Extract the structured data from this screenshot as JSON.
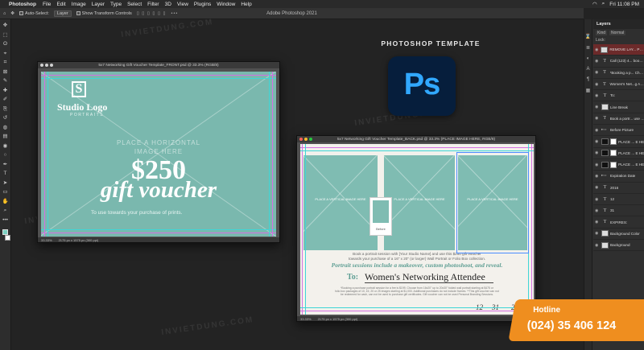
{
  "menubar": {
    "app_name": "Photoshop",
    "items": [
      "File",
      "Edit",
      "Image",
      "Layer",
      "Type",
      "Select",
      "Filter",
      "3D",
      "View",
      "Plugins",
      "Window",
      "Help"
    ],
    "clock": "Fri 11:08 PM",
    "window_title": "Adobe Photoshop 2021"
  },
  "optionsbar": {
    "auto_select_label": "Auto-Select:",
    "auto_select_value": "Layer",
    "show_transform_label": "Show Transform Controls",
    "more": "•••"
  },
  "toolbar": {
    "tools": [
      "move-icon",
      "marquee-icon",
      "lasso-icon",
      "object-select-icon",
      "crop-icon",
      "frame-icon",
      "eyedropper-icon",
      "healing-icon",
      "brush-icon",
      "stamp-icon",
      "history-brush-icon",
      "eraser-icon",
      "gradient-icon",
      "blur-icon",
      "dodge-icon",
      "pen-icon",
      "type-icon",
      "path-select-icon",
      "rectangle-icon",
      "hand-icon",
      "zoom-icon",
      "more-tools-icon"
    ],
    "glyphs": [
      "✥",
      "⬚",
      "ʘ",
      "⌖",
      "⌗",
      "⊠",
      "✎",
      "✚",
      "✐",
      "⎘",
      "↺",
      "◍",
      "▤",
      "◉",
      "○",
      "✒",
      "T",
      "➤",
      "▭",
      "✋",
      "⌕",
      "•••"
    ],
    "fg_color": "#7dd1c2",
    "bg_color": "#ffffff"
  },
  "layers_panel": {
    "tab": "Layers",
    "filter_kind": "Kind",
    "blend_mode": "Normal",
    "lock_label": "Lock:",
    "layers": [
      {
        "name": "REMOVE LAY... PRINTI",
        "type": "image",
        "state": "active-red"
      },
      {
        "name": "Call (123) 4... book yo",
        "type": "text",
        "state": ""
      },
      {
        "name": "*Booking a p... Choose",
        "type": "text",
        "state": ""
      },
      {
        "name": "Women's Net...g Attend",
        "type": "text",
        "state": ""
      },
      {
        "name": "To:",
        "type": "text",
        "state": ""
      },
      {
        "name": "Line Break",
        "type": "image",
        "state": ""
      },
      {
        "name": "Book a portr... use this",
        "type": "text",
        "state": ""
      },
      {
        "name": "Before Picture",
        "type": "folder",
        "state": ""
      },
      {
        "name": "PLACE ... E HE",
        "type": "masked",
        "state": ""
      },
      {
        "name": "PLACE ... E HE",
        "type": "masked",
        "state": ""
      },
      {
        "name": "PLACE ... E HE",
        "type": "masked",
        "state": ""
      },
      {
        "name": "Expiration Date",
        "type": "folder",
        "state": ""
      },
      {
        "name": "2016",
        "type": "text",
        "state": ""
      },
      {
        "name": "12",
        "type": "text",
        "state": ""
      },
      {
        "name": "31",
        "type": "text",
        "state": ""
      },
      {
        "name": "EXPIRES:",
        "type": "text",
        "state": ""
      },
      {
        "name": "Background Color",
        "type": "image",
        "state": ""
      },
      {
        "name": "Background",
        "type": "image",
        "state": ""
      }
    ]
  },
  "front_doc": {
    "title": "5x7 Networking Gift Voucher Template_FRONT.psd @ 33.3% (RGB/8)",
    "zoom": "33.33%",
    "size": "2175 px x 1575 px (300 ppi)",
    "logo_letter": "S",
    "logo_title": "Studio Logo",
    "logo_sub": "PORTRAITS",
    "placeholder": "PLACE A HORIZONTAL",
    "placeholder2": "IMAGE HERE",
    "amount": "$250",
    "gift": "gift voucher",
    "towards": "To use towards your purchase of prints."
  },
  "back_doc": {
    "title": "5x7 Networking Gift Voucher Template_BACK.psd @ 33.3% (PLACE IMAGE HERE, RGB/8)",
    "zoom": "33.33%",
    "size": "2175 px x 1575 px (300 ppi)",
    "photo_label": "PLACE A VERTICAL IMAGE HERE",
    "frame_caption": "Before",
    "body1": "Book a portrait session with [Your Studio Name] and use this $250 gift voucher",
    "body2": "towards your purchase of a 16\" x 20\" (or larger) Wall Portrait or Folio Box collection.",
    "italic": "Portrait sessions include a makeover, custom photoshoot, and reveal.",
    "to_label": "To:",
    "to_name": "Women's Networking Attendee",
    "fine1": "*Booking a purchase portrait session for a fee is $199. Choose from 16x20\" up to 20x30\" folded wall portrait starting at $475 or",
    "fine2": "folio box packages of 10, 15, 20 or 25 images starting at $1,000. Additional purchases do not include frames. **This gift voucher can not",
    "fine3": "be redeemed for cash, can not be used to purchase gift certificates. Gift voucher can not be used Personal Branding Sessions.",
    "date_m": "12",
    "date_d": "31",
    "date_y": "20"
  },
  "branding": {
    "title": "PHOTOSHOP TEMPLATE",
    "logo_text": "Ps",
    "watermark": "INVIETDUNG.COM",
    "hotline_label": "Hotline",
    "hotline_number": "(024) 35 406 124",
    "accent": "#ef8e1f",
    "ps_blue": "#31a8ff",
    "ps_dark": "#061e3c"
  }
}
